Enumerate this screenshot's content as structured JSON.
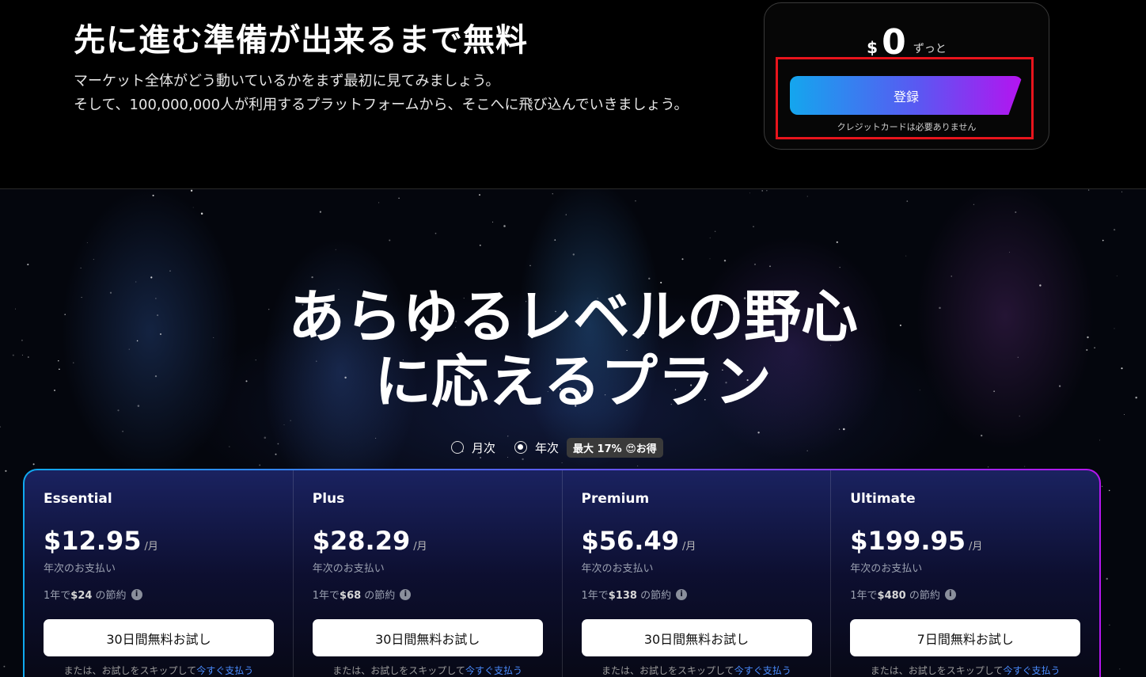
{
  "free": {
    "title": "先に進む準備が出来るまで無料",
    "desc1": "マーケット全体がどう動いているかをまず最初に見てみましょう。",
    "desc2": "そして、100,000,000人が利用するプラットフォームから、そこへに飛び込んでいきましょう。",
    "currency": "$",
    "price": "0",
    "price_suffix": "ずっと",
    "signup_label": "登録",
    "no_card": "クレジットカードは必要ありません"
  },
  "plans_section": {
    "title_line1": "あらゆるレベルの野心",
    "title_line2": "に応えるプラン",
    "billing": {
      "monthly": "月次",
      "yearly": "年次",
      "selected": "年次",
      "badge": "最大 17% 😍お得"
    },
    "plans": [
      {
        "name": "Essential",
        "price": "$12.95",
        "unit": "/月",
        "billed": "年次のお支払い",
        "save_prefix": "1年で",
        "save_amount": "$24",
        "save_suffix": " の節約",
        "trial": "30日間無料お試し",
        "skip_text": "または、お試しをスキップして",
        "skip_link": "今すぐ支払う"
      },
      {
        "name": "Plus",
        "price": "$28.29",
        "unit": "/月",
        "billed": "年次のお支払い",
        "save_prefix": "1年で",
        "save_amount": "$68",
        "save_suffix": " の節約",
        "trial": "30日間無料お試し",
        "skip_text": "または、お試しをスキップして",
        "skip_link": "今すぐ支払う"
      },
      {
        "name": "Premium",
        "price": "$56.49",
        "unit": "/月",
        "billed": "年次のお支払い",
        "save_prefix": "1年で",
        "save_amount": "$138",
        "save_suffix": " の節約",
        "trial": "30日間無料お試し",
        "skip_text": "または、お試しをスキップして",
        "skip_link": "今すぐ支払う"
      },
      {
        "name": "Ultimate",
        "price": "$199.95",
        "unit": "/月",
        "billed": "年次のお支払い",
        "save_prefix": "1年で",
        "save_amount": "$480",
        "save_suffix": " の節約",
        "trial": "7日間無料お試し",
        "skip_text": "または、お試しをスキップして",
        "skip_link": "今すぐ支払う"
      }
    ]
  },
  "colors": {
    "highlight_border": "#e8141c",
    "gradient_start": "#14a6ee",
    "gradient_end": "#b513f0",
    "link": "#4a8cff"
  }
}
